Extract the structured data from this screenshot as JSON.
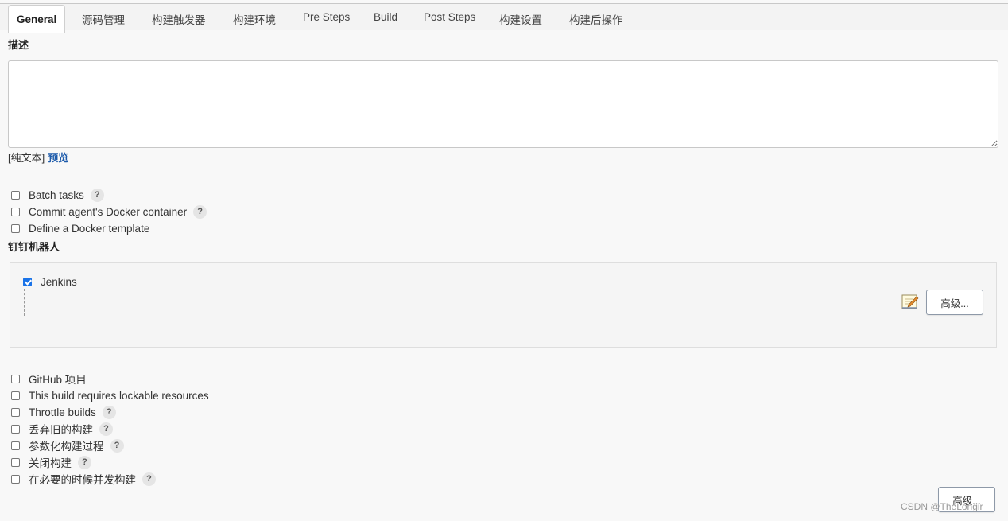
{
  "tabs": [
    {
      "label": "General",
      "active": true
    },
    {
      "label": "源码管理"
    },
    {
      "label": "构建触发器"
    },
    {
      "label": "构建环境"
    },
    {
      "label": "Pre Steps"
    },
    {
      "label": "Build"
    },
    {
      "label": "Post Steps"
    },
    {
      "label": "构建设置"
    },
    {
      "label": "构建后操作"
    }
  ],
  "description": {
    "label": "描述",
    "value": "",
    "format_prefix": "[纯文本]",
    "preview_link": "预览"
  },
  "options_top": [
    {
      "label": "Batch tasks",
      "checked": false,
      "help": "?"
    },
    {
      "label": "Commit agent's Docker container",
      "checked": false,
      "help": "?"
    },
    {
      "label": "Define a Docker template",
      "checked": false
    }
  ],
  "dingtalk": {
    "section_label": "钉钉机器人",
    "robot_label": "Jenkins",
    "robot_checked": true,
    "note_icon": "notepad-pencil-icon",
    "advanced_button": "高级..."
  },
  "options_bottom": [
    {
      "label": "GitHub 项目",
      "checked": false
    },
    {
      "label": "This build requires lockable resources",
      "checked": false
    },
    {
      "label": "Throttle builds",
      "checked": false,
      "help": "?"
    },
    {
      "label": "丢弃旧的构建",
      "checked": false,
      "help": "?"
    },
    {
      "label": "参数化构建过程",
      "checked": false,
      "help": "?"
    },
    {
      "label": "关闭构建",
      "checked": false,
      "help": "?"
    },
    {
      "label": "在必要的时候并发构建",
      "checked": false,
      "help": "?"
    }
  ],
  "footer": {
    "advanced_button": "高级...",
    "watermark": "CSDN @TheLongir"
  },
  "colors": {
    "checkbox_checked": "#1a73e8",
    "link": "#1d5bab",
    "background": "#f8f8f8"
  }
}
